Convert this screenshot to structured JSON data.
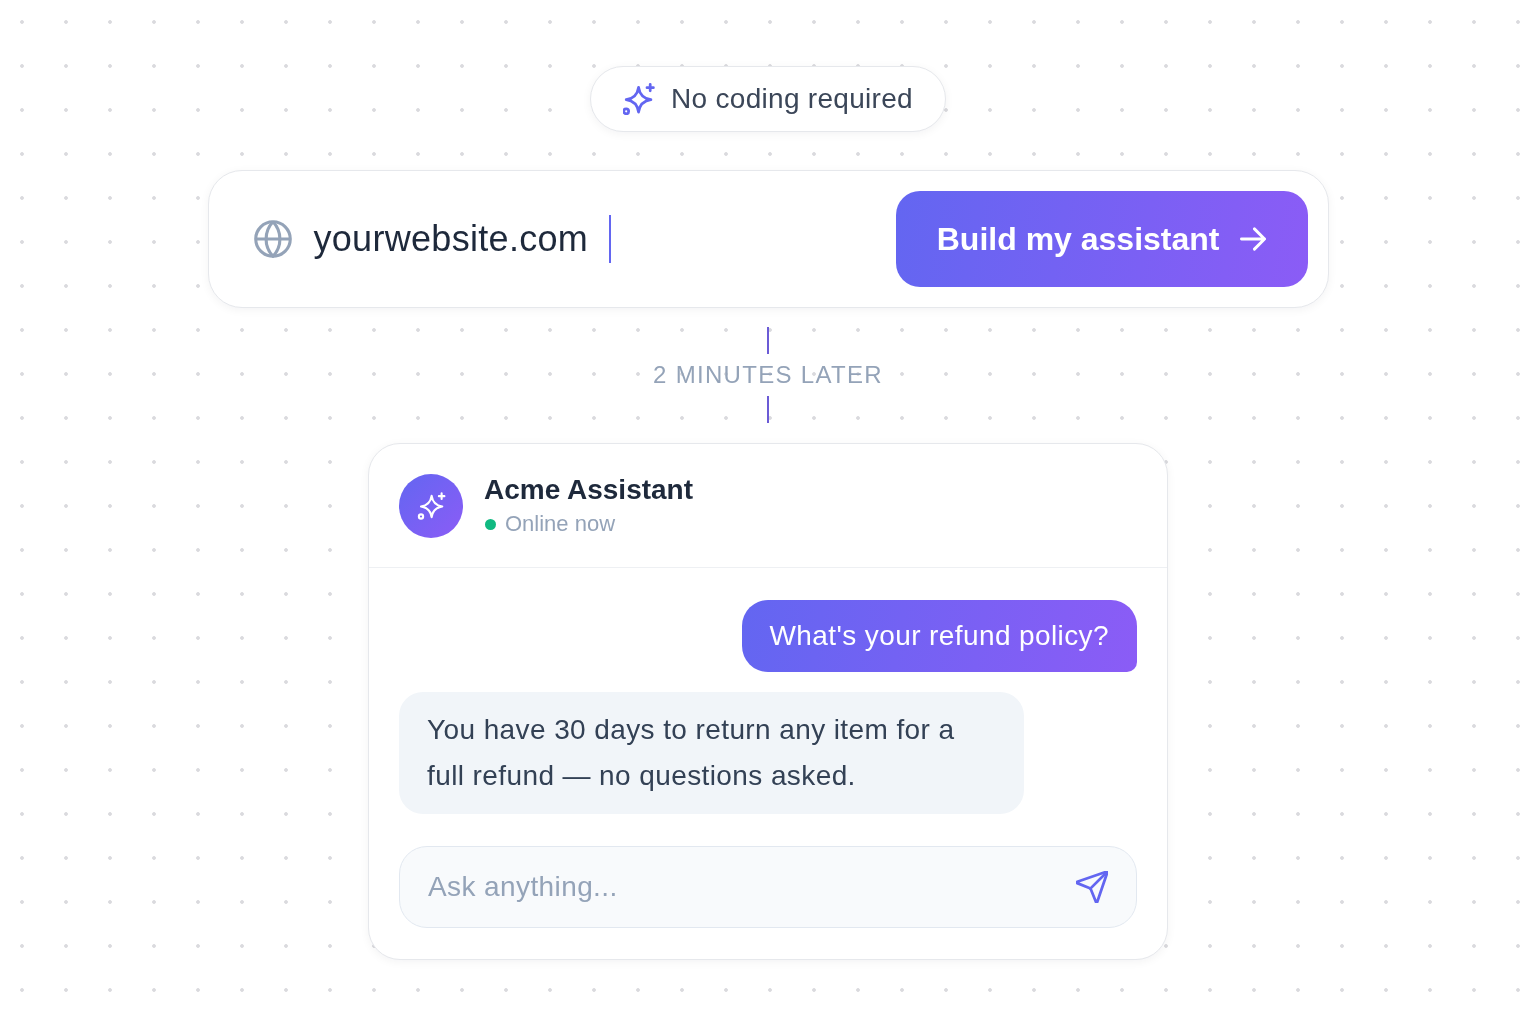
{
  "badge": {
    "label": "No coding required"
  },
  "url_bar": {
    "value": "yourwebsite.com",
    "focused": true,
    "button": "Build my assistant"
  },
  "divider": {
    "label": "2 MINUTES LATER"
  },
  "chat": {
    "title": "Acme Assistant",
    "status": {
      "label": "Online now",
      "online": true
    },
    "messages": [
      {
        "kind": "user",
        "text": "What's your refund policy?"
      },
      {
        "kind": "assistant",
        "text": "You have 30 days to return any item for a full refund — no questions asked."
      }
    ],
    "composer": {
      "placeholder": "Ask anything..."
    }
  }
}
